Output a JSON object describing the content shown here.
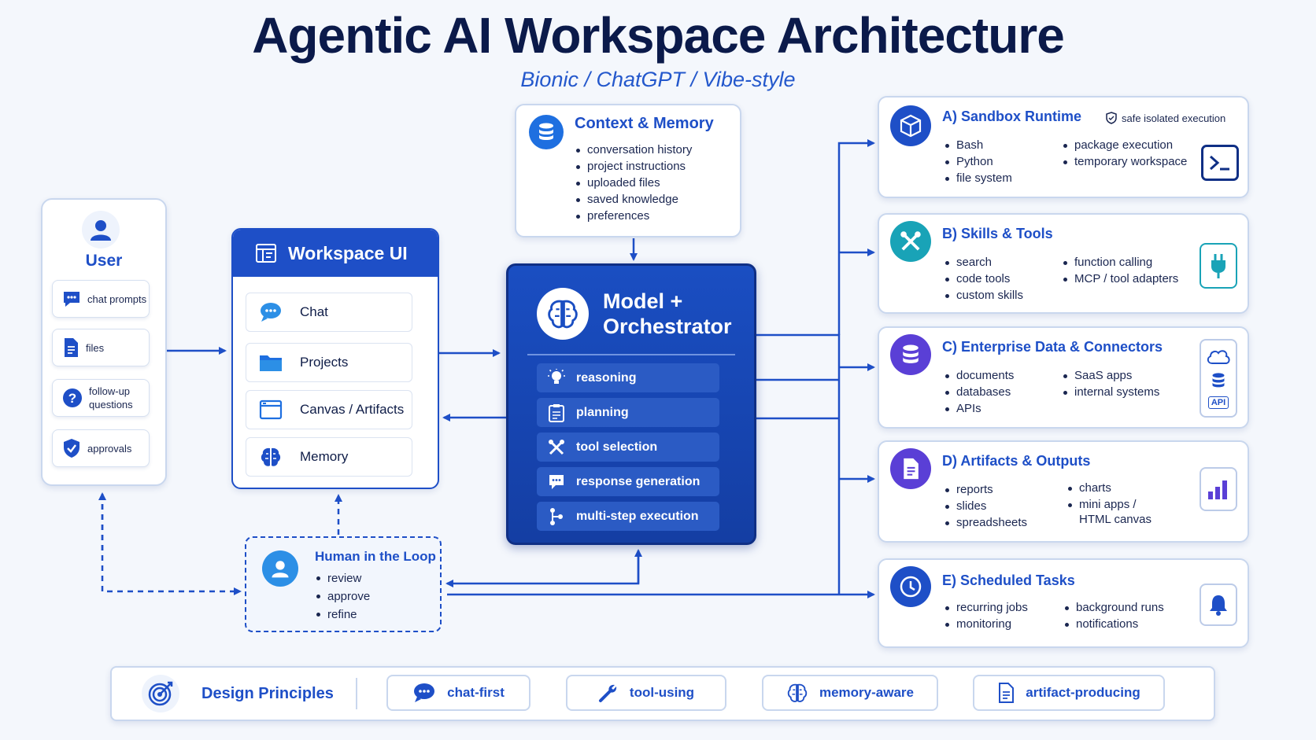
{
  "title": "Agentic AI Workspace Architecture",
  "subtitle": "Bionic / ChatGPT / Vibe-style",
  "user": {
    "title": "User",
    "items": [
      "chat prompts",
      "files",
      "follow-up questions",
      "approvals"
    ]
  },
  "workspace": {
    "title": "Workspace UI",
    "items": [
      "Chat",
      "Projects",
      "Canvas / Artifacts",
      "Memory"
    ]
  },
  "context": {
    "title": "Context & Memory",
    "items": [
      "conversation history",
      "project instructions",
      "uploaded files",
      "saved knowledge",
      "preferences"
    ]
  },
  "orchestrator": {
    "title_line1": "Model +",
    "title_line2": "Orchestrator",
    "items": [
      "reasoning",
      "planning",
      "tool selection",
      "response generation",
      "multi-step execution"
    ]
  },
  "hitl": {
    "title": "Human in the Loop",
    "items": [
      "review",
      "approve",
      "refine"
    ]
  },
  "sandbox": {
    "title": "A) Sandbox Runtime",
    "badge": "safe isolated execution",
    "col1": [
      "Bash",
      "Python",
      "file system"
    ],
    "col2": [
      "package execution",
      "temporary workspace"
    ]
  },
  "skills": {
    "title": "B) Skills & Tools",
    "col1": [
      "search",
      "code tools",
      "custom skills"
    ],
    "col2": [
      "function calling",
      "MCP / tool adapters"
    ]
  },
  "enterprise": {
    "title": "C) Enterprise Data & Connectors",
    "col1": [
      "documents",
      "databases",
      "APIs"
    ],
    "col2": [
      "SaaS apps",
      "internal systems"
    ],
    "api_label": "API"
  },
  "artifacts": {
    "title": "D) Artifacts & Outputs",
    "col1": [
      "reports",
      "slides",
      "spreadsheets"
    ],
    "col2_1": "charts",
    "col2_2a": "mini apps /",
    "col2_2b": "HTML canvas"
  },
  "scheduled": {
    "title": "E) Scheduled Tasks",
    "col1": [
      "recurring jobs",
      "monitoring"
    ],
    "col2": [
      "background runs",
      "notifications"
    ]
  },
  "principles": {
    "title": "Design Principles",
    "items": [
      "chat-first",
      "tool-using",
      "memory-aware",
      "artifact-producing"
    ]
  },
  "colors": {
    "primary": "#1e4fc7",
    "navy": "#0b1a4a",
    "orchestrator_bg": "#1846b4",
    "teal": "#19a3b7",
    "purple": "#5a3fd6"
  }
}
